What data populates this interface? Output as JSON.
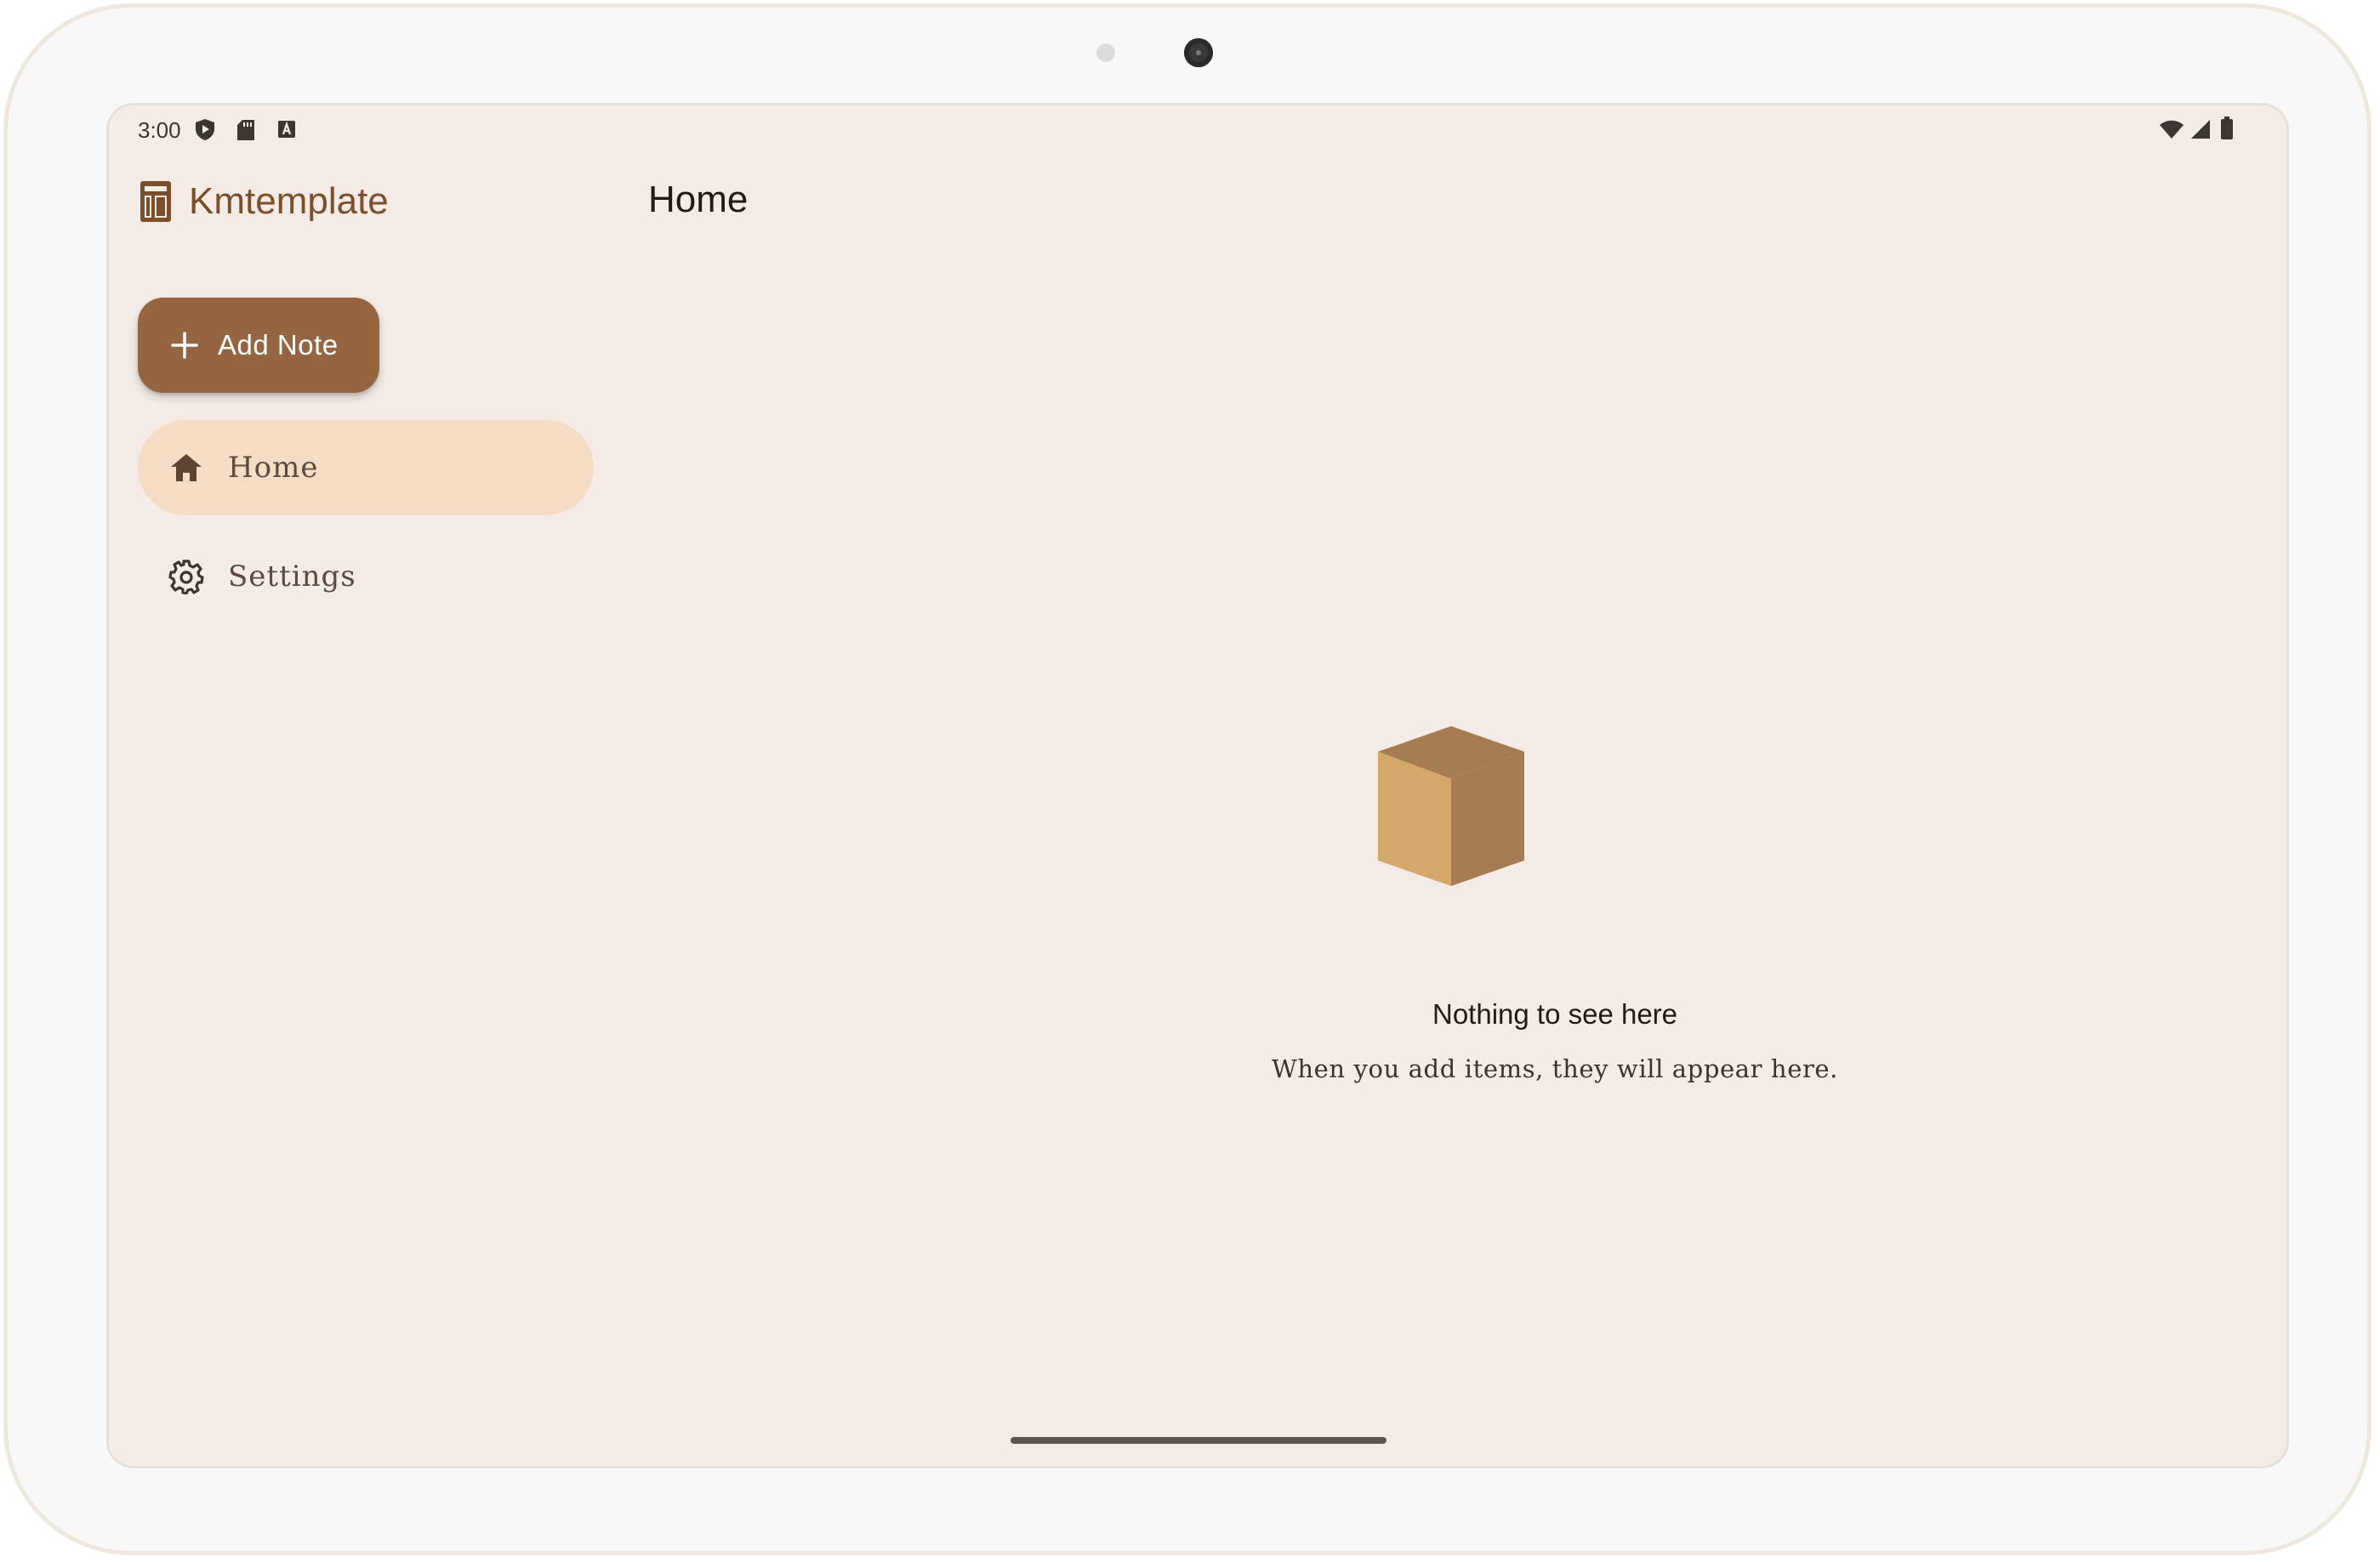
{
  "status_bar": {
    "time": "3:00",
    "left_icons": [
      "shield-play-icon",
      "sd-card-icon",
      "keyboard-a-icon"
    ],
    "right_icons": [
      "wifi-icon",
      "cell-signal-icon",
      "battery-icon"
    ]
  },
  "drawer": {
    "app_title": "Kmtemplate",
    "add_note_label": "Add Note",
    "items": [
      {
        "label": "Home",
        "icon": "home-icon",
        "selected": true
      },
      {
        "label": "Settings",
        "icon": "gear-icon",
        "selected": false
      }
    ]
  },
  "main": {
    "title": "Home",
    "empty_state": {
      "icon": "box-icon",
      "title": "Nothing to see here",
      "subtitle": "When you add items, they will appear here."
    }
  },
  "colors": {
    "background": "#f5ebe6",
    "primary": "#946540",
    "accent_text": "#7a4f2c",
    "selected_nav": "#f5dcc4",
    "box_light": "#d4a76a",
    "box_dark": "#a67c52"
  }
}
